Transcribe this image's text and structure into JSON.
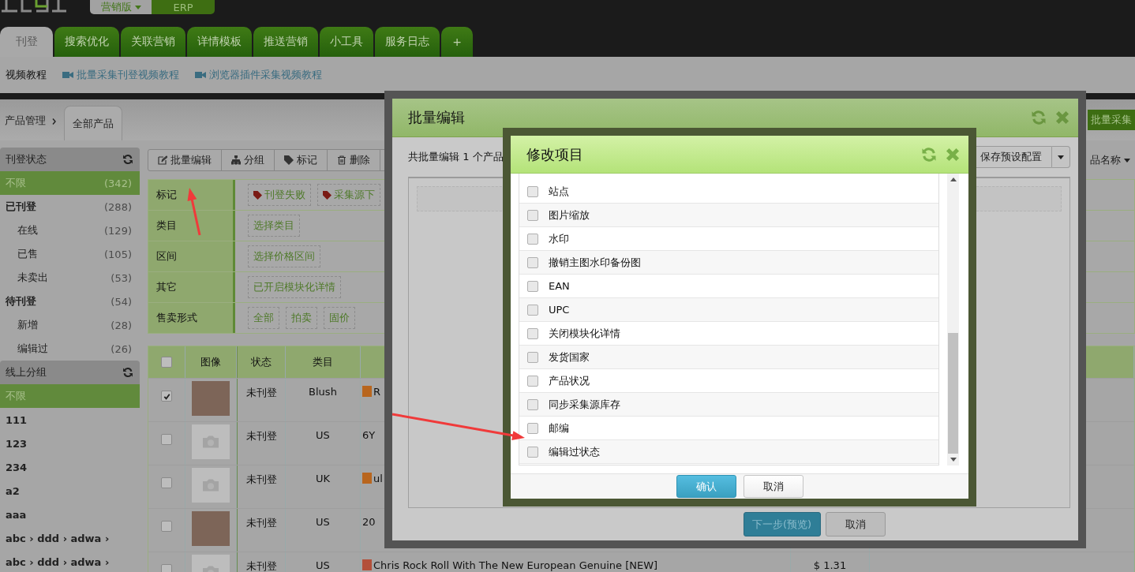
{
  "header": {
    "edition_menu": "营销版",
    "erp_button": "ERP"
  },
  "tabs": [
    {
      "label": "刊登",
      "selected": true
    },
    {
      "label": "搜索优化",
      "selected": false
    },
    {
      "label": "关联营销",
      "selected": false
    },
    {
      "label": "详情模板",
      "selected": false
    },
    {
      "label": "推送营销",
      "selected": false
    },
    {
      "label": "小工具",
      "selected": false
    },
    {
      "label": "服务日志",
      "selected": false
    },
    {
      "label": "+",
      "selected": false
    }
  ],
  "video_bar": {
    "label": "视频教程",
    "links": [
      "批量采集刊登视频教程",
      "浏览器插件采集视频教程"
    ]
  },
  "breadcrumb": {
    "root": "产品管理",
    "tabs": [
      {
        "label": "全部产品",
        "selected": true
      }
    ],
    "collect_button": "批量采集"
  },
  "sidebar": {
    "sections": [
      {
        "title": "刊登状态",
        "items": [
          {
            "label": "不限",
            "count": "(342)",
            "kind": "all",
            "selected": true
          },
          {
            "label": "已刊登",
            "count": "(288)",
            "kind": "group",
            "selected": false,
            "children": [
              {
                "label": "在线",
                "count": "(129)",
                "kind": "sub",
                "selected": false
              },
              {
                "label": "已售",
                "count": "(105)",
                "kind": "sub",
                "selected": false
              },
              {
                "label": "未卖出",
                "count": "(53)",
                "kind": "sub",
                "selected": false
              }
            ]
          },
          {
            "label": "待刊登",
            "count": "(54)",
            "kind": "group",
            "selected": false,
            "children": [
              {
                "label": "新增",
                "count": "(28)",
                "kind": "sub",
                "selected": false
              },
              {
                "label": "编辑过",
                "count": "(26)",
                "kind": "sub",
                "selected": false
              }
            ]
          }
        ]
      },
      {
        "title": "线上分组",
        "items": [
          {
            "label": "不限",
            "kind": "all",
            "selected": true
          },
          {
            "label": "111",
            "kind": "group",
            "selected": false
          },
          {
            "label": "123",
            "kind": "group",
            "selected": false
          },
          {
            "label": "234",
            "kind": "group",
            "selected": false
          },
          {
            "label": "a2",
            "kind": "group",
            "selected": false
          },
          {
            "label": "aaa",
            "kind": "group",
            "selected": false
          },
          {
            "label": "abc › ddd › adwa ›",
            "kind": "group",
            "selected": false
          },
          {
            "label": "abc › ddd › adwa ›",
            "kind": "group",
            "selected": false
          }
        ]
      }
    ]
  },
  "toolbar": {
    "buttons": [
      {
        "label": "批量编辑",
        "kind": "edit"
      },
      {
        "label": "分组",
        "kind": "group"
      },
      {
        "label": "标记",
        "kind": "tag"
      },
      {
        "label": "删除",
        "kind": "delete"
      }
    ],
    "sort_menu": "品名称"
  },
  "filters": [
    {
      "label": "标记",
      "options": [
        {
          "text": "刊登失败",
          "kind": "tag"
        },
        {
          "text": "采集源下",
          "kind": "tag"
        }
      ]
    },
    {
      "label": "类目",
      "options": [
        {
          "text": "选择类目",
          "kind": "plain"
        }
      ]
    },
    {
      "label": "区间",
      "options": [
        {
          "text": "选择价格区间",
          "kind": "plain"
        }
      ]
    },
    {
      "label": "其它",
      "options": [
        {
          "text": "已开启模块化详情",
          "kind": "plain"
        }
      ]
    },
    {
      "label": "售卖形式",
      "options": [
        {
          "text": "全部",
          "kind": "plain"
        },
        {
          "text": "拍卖",
          "kind": "plain"
        },
        {
          "text": "固价",
          "kind": "plain"
        }
      ]
    }
  ],
  "products": {
    "all_checked": false,
    "columns": [
      "图像",
      "状态",
      "类目"
    ],
    "rows": [
      {
        "checked": true,
        "image": {
          "kind": "photo"
        },
        "status": "未刊登",
        "category": "Blush",
        "source": {
          "kind": "ebay"
        },
        "title": "R"
      },
      {
        "checked": false,
        "image": {
          "kind": "placeholder"
        },
        "status": "未刊登",
        "category": "US",
        "title": "6Y"
      },
      {
        "checked": false,
        "image": {
          "kind": "placeholder"
        },
        "status": "未刊登",
        "category": "UK",
        "source": {
          "kind": "ebay"
        },
        "title": "ul"
      },
      {
        "checked": false,
        "image": {
          "kind": "photo"
        },
        "status": "未刊登",
        "category": "US",
        "title": "20"
      },
      {
        "checked": false,
        "image": {
          "kind": "placeholder"
        },
        "status": "未刊登",
        "category": "US",
        "source": {
          "kind": "taobao"
        },
        "title": "Chris Rock Roll With The New European Genuine [NEW]",
        "price": "$ 1.31"
      }
    ]
  },
  "batch_edit": {
    "title": "批量编辑",
    "summary": "共批量编辑 1 个产品",
    "save_button": "保存预设配置",
    "next_button": "下一步(预览)",
    "cancel_button": "取消"
  },
  "modify_items": {
    "title": "修改项目",
    "items": [
      {
        "label": "站点",
        "checked": false
      },
      {
        "label": "图片缩放",
        "checked": false
      },
      {
        "label": "水印",
        "checked": false
      },
      {
        "label": "撤销主图水印备份图",
        "checked": false
      },
      {
        "label": "EAN",
        "checked": false
      },
      {
        "label": "UPC",
        "checked": false
      },
      {
        "label": "关闭模块化详情",
        "checked": false
      },
      {
        "label": "发货国家",
        "checked": false
      },
      {
        "label": "产品状况",
        "checked": false
      },
      {
        "label": "同步采集源库存",
        "checked": false
      },
      {
        "label": "邮编",
        "checked": false
      },
      {
        "label": "编辑过状态",
        "checked": false
      }
    ],
    "confirm_button": "确认",
    "cancel_button": "取消"
  }
}
